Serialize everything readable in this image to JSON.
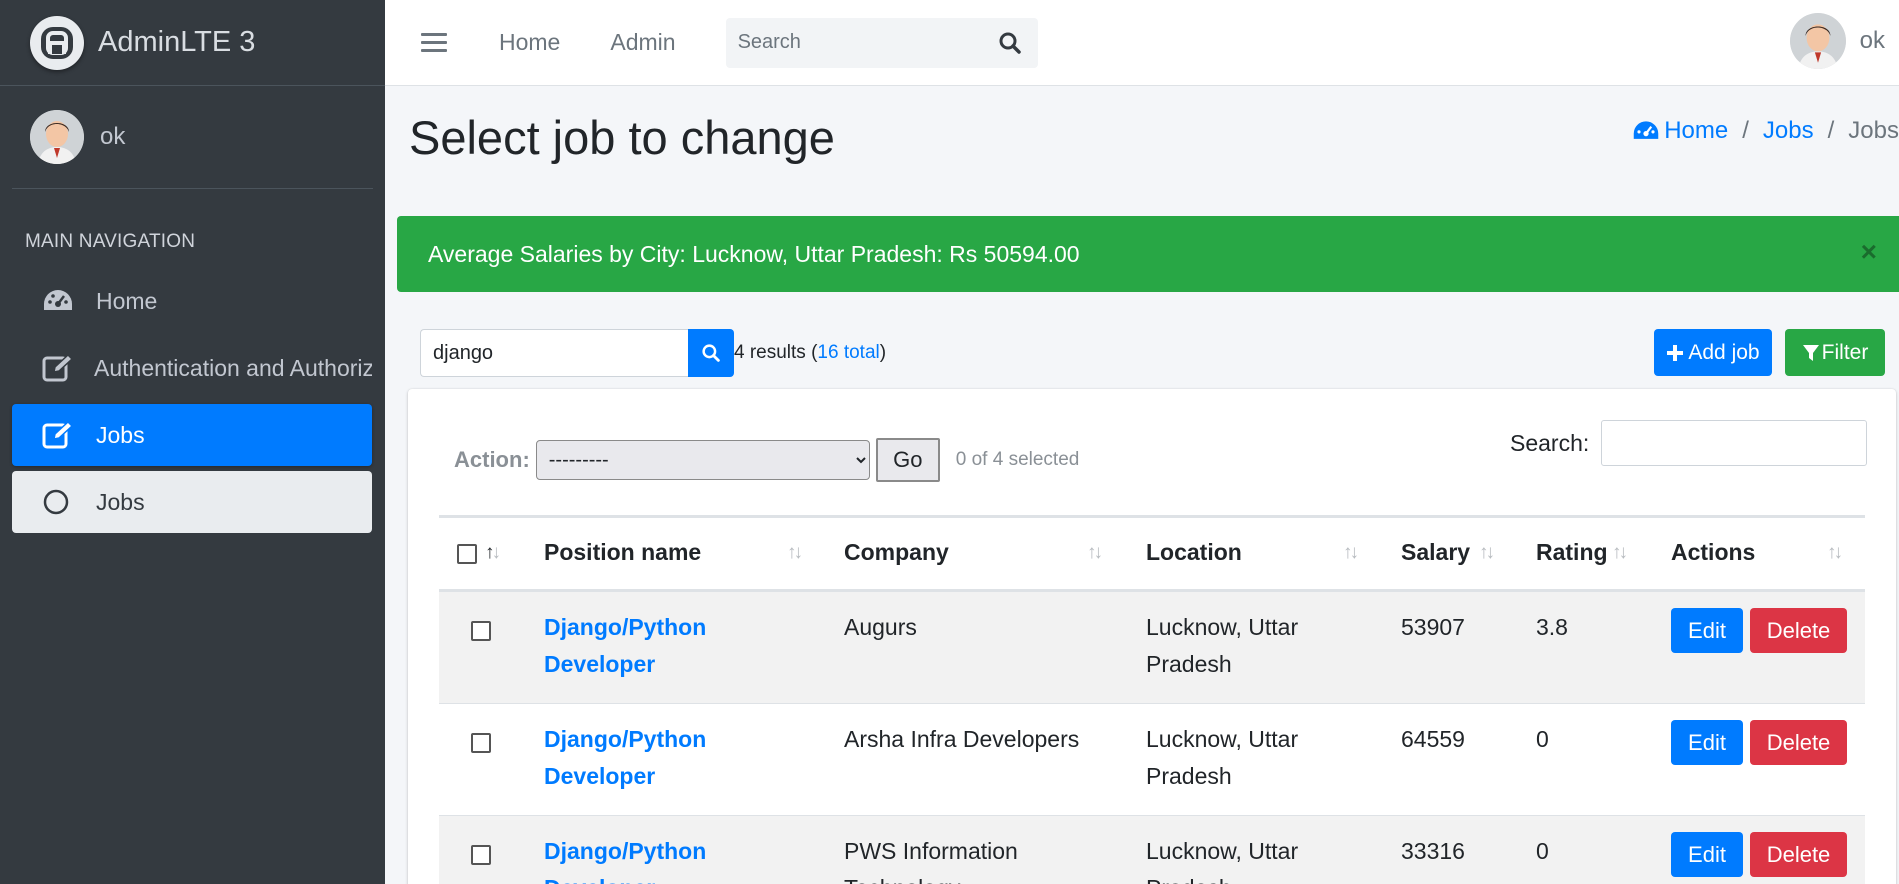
{
  "brand": {
    "name": "AdminLTE 3"
  },
  "sidebar": {
    "user": "ok",
    "nav_header": "MAIN NAVIGATION",
    "items": [
      {
        "label": "Home",
        "icon": "tachometer-icon"
      },
      {
        "label": "Authentication and Authorization",
        "icon": "edit-icon"
      },
      {
        "label": "Jobs",
        "icon": "edit-icon",
        "active": true
      },
      {
        "label": "Jobs",
        "icon": "circle-icon",
        "sub": true
      }
    ]
  },
  "topbar": {
    "links": [
      "Home",
      "Admin"
    ],
    "search_placeholder": "Search",
    "user": "ok"
  },
  "page": {
    "title": "Select job to change",
    "breadcrumb": {
      "home": "Home",
      "jobs": "Jobs",
      "current": "Jobs"
    }
  },
  "alert": {
    "message": "Average Salaries by City: Lucknow, Uttar Pradesh: Rs 50594.00",
    "close": "×"
  },
  "list_search": {
    "value": "django",
    "results_prefix": "4 results (",
    "total_link": "16 total",
    "results_suffix": ")"
  },
  "buttons": {
    "add": "Add job",
    "filter": "Filter"
  },
  "actions": {
    "label": "Action:",
    "selected_option": "---------",
    "go": "Go",
    "selected_count": "0 of 4 selected",
    "search_label": "Search:"
  },
  "table": {
    "headers": [
      "Position name",
      "Company",
      "Location",
      "Salary",
      "Rating",
      "Actions"
    ],
    "rows": [
      {
        "position": "Django/Python Developer",
        "company": "Augurs",
        "location": "Lucknow, Uttar Pradesh",
        "salary": "53907",
        "rating": "3.8"
      },
      {
        "position": "Django/Python Developer",
        "company": "Arsha Infra Developers",
        "location": "Lucknow, Uttar Pradesh",
        "salary": "64559",
        "rating": "0"
      },
      {
        "position": "Django/Python Developer",
        "company": "PWS Information Technology",
        "location": "Lucknow, Uttar Pradesh",
        "salary": "33316",
        "rating": "0"
      }
    ],
    "edit_label": "Edit",
    "delete_label": "Delete"
  },
  "colors": {
    "primary": "#007bff",
    "success": "#28a745",
    "danger": "#dc3545",
    "sidebar_bg": "#343a40"
  }
}
